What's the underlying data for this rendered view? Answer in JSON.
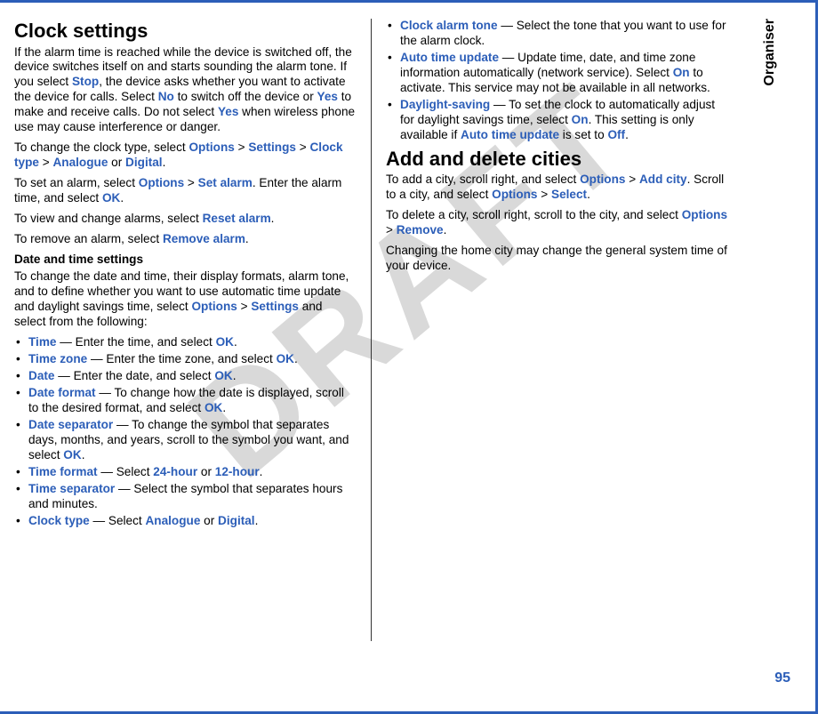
{
  "side_tab": "Organiser",
  "watermark": "DRAFT",
  "page_number": "95",
  "left": {
    "title": "Clock settings",
    "p1_a": "If the alarm time is reached while the device is switched off, the device switches itself on and starts sounding the alarm tone. If you select ",
    "stop": "Stop",
    "p1_b": ", the device asks whether you want to activate the device for calls. Select ",
    "no": "No",
    "p1_c": " to switch off the device or ",
    "yes1": "Yes",
    "p1_d": " to make and receive calls. Do not select ",
    "yes2": "Yes",
    "p1_e": " when wireless phone use may cause interference or danger.",
    "p2_a": "To change the clock type, select ",
    "p2_options": "Options",
    "gt": ">",
    "p2_settings": "Settings",
    "p2_clocktype": "Clock type",
    "p2_analogue": "Analogue",
    "or": " or ",
    "p2_digital": "Digital",
    "p3_a": "To set an alarm, select ",
    "p3_options": "Options",
    "p3_setalarm": "Set alarm",
    "p3_b": ". Enter the alarm time, and select ",
    "p3_ok": "OK",
    "p4_a": "To view and change alarms, select ",
    "p4_reset": "Reset alarm",
    "p5_a": "To remove an alarm, select ",
    "p5_remove": "Remove alarm",
    "sub1": "Date and time settings",
    "p6_a": "To change the date and time, their display formats, alarm tone, and to define whether you want to use automatic time update and daylight savings time, select ",
    "p6_options": "Options",
    "p6_settings": "Settings",
    "p6_b": " and select from the following:",
    "items": [
      {
        "kw": "Time",
        "text": " — Enter the time, and select ",
        "end_kw": "OK",
        "end": "."
      },
      {
        "kw": "Time zone",
        "text": " — Enter the time zone, and select ",
        "end_kw": "OK",
        "end": "."
      },
      {
        "kw": "Date",
        "text": " — Enter the date, and select ",
        "end_kw": "OK",
        "end": "."
      },
      {
        "kw": "Date format",
        "text": " — To change how the date is displayed, scroll to the desired format, and select ",
        "end_kw": "OK",
        "end": "."
      },
      {
        "kw": "Date separator",
        "text": " — To change the symbol that separates days, months, and years, scroll to the symbol you want, and select ",
        "end_kw": "OK",
        "end": "."
      },
      {
        "kw": "Time format",
        "text": " — Select ",
        "end_kw": "24-hour",
        "mid": " or ",
        "end_kw2": "12-hour",
        "end": "."
      },
      {
        "kw": "Time separator",
        "text": " — Select the symbol that separates hours and minutes.",
        "end_kw": "",
        "end": ""
      },
      {
        "kw": "Clock type",
        "text": " — Select ",
        "end_kw": "Analogue",
        "mid": " or ",
        "end_kw2": "Digital",
        "end": "."
      }
    ]
  },
  "right": {
    "items": [
      {
        "kw": "Clock alarm tone",
        "text": " — Select the tone that you want to use for the alarm clock."
      },
      {
        "kw": "Auto time update",
        "text_a": " — Update time, date, and time zone information automatically (network service). Select ",
        "kw2": "On",
        "text_b": " to activate. This service may not be available in all networks."
      },
      {
        "kw": "Daylight-saving",
        "text_a": " — To set the clock to automatically adjust for daylight savings time, select ",
        "kw2": "On",
        "text_b": ". This setting is only available if ",
        "kw3": "Auto time update",
        "text_c": " is set to ",
        "kw4": "Off",
        "text_d": "."
      }
    ],
    "title": "Add and delete cities",
    "p1_a": "To add a city, scroll right, and select ",
    "p1_options": "Options",
    "gt": ">",
    "p1_addcity": "Add city",
    "p1_b": ". Scroll to a city, and select ",
    "p1_options2": "Options",
    "p1_select": "Select",
    "p2_a": "To delete a city, scroll right, scroll to the city, and select ",
    "p2_options": "Options",
    "p2_remove": "Remove",
    "p3": "Changing the home city may change the general system time of your device."
  }
}
